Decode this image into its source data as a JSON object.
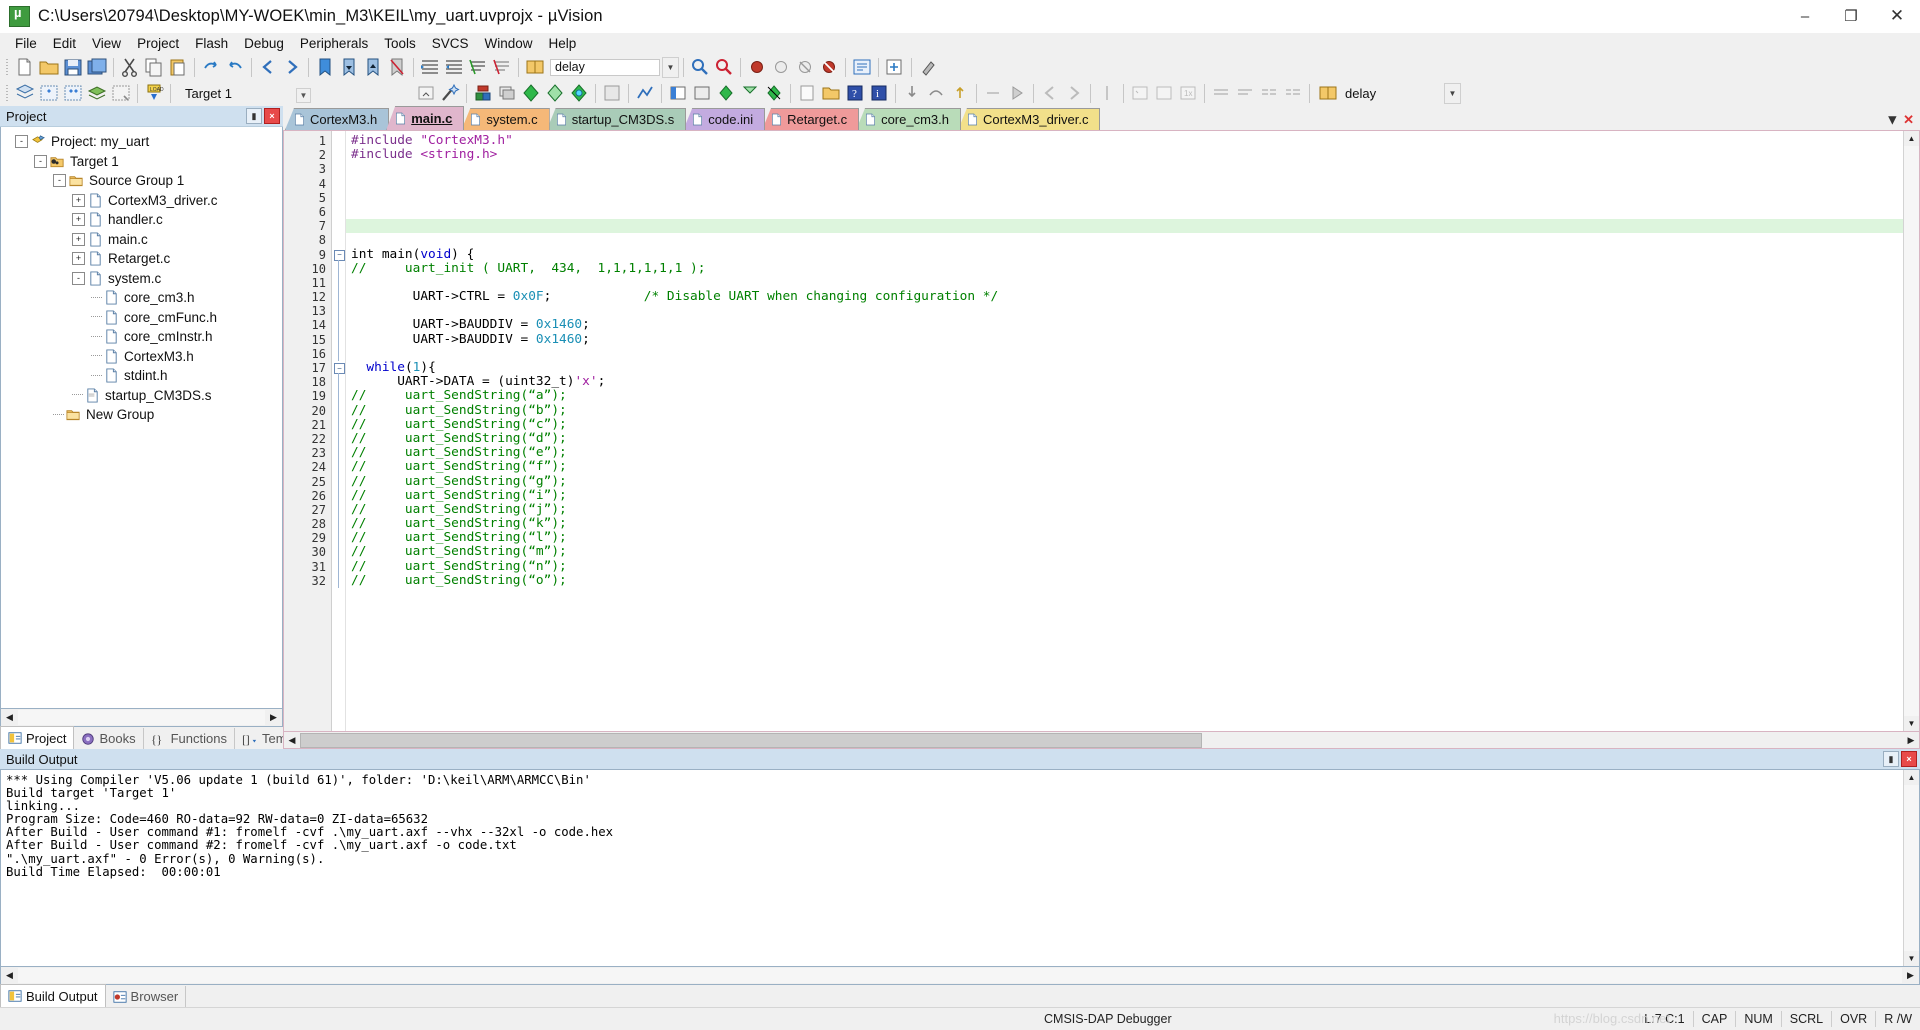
{
  "window": {
    "title": "C:\\Users\\20794\\Desktop\\MY-WOEK\\min_M3\\KEIL\\my_uart.uvprojx - µVision",
    "minimize": "–",
    "maximize": "❐",
    "close": "✕"
  },
  "menubar": {
    "items": [
      {
        "label": "File"
      },
      {
        "label": "Edit"
      },
      {
        "label": "View"
      },
      {
        "label": "Project"
      },
      {
        "label": "Flash"
      },
      {
        "label": "Debug"
      },
      {
        "label": "Peripherals"
      },
      {
        "label": "Tools"
      },
      {
        "label": "SVCS"
      },
      {
        "label": "Window"
      },
      {
        "label": "Help"
      }
    ]
  },
  "toolbar2": {
    "target_value": "Target 1",
    "target_arrow": "▼"
  },
  "toolbar1": {
    "find_value": "delay",
    "find_arrow": "▼",
    "zoom_value": ""
  },
  "project_pane": {
    "caption": "Project",
    "pin": "▮",
    "close": "×",
    "tree": [
      {
        "depth": 0,
        "expander": "-",
        "icon": "project-icon",
        "label": "Project: my_uart"
      },
      {
        "depth": 1,
        "expander": "-",
        "icon": "target-icon",
        "label": "Target 1"
      },
      {
        "depth": 2,
        "expander": "-",
        "icon": "folder-icon",
        "label": "Source Group 1"
      },
      {
        "depth": 3,
        "expander": "+",
        "icon": "c-file-icon",
        "label": "CortexM3_driver.c"
      },
      {
        "depth": 3,
        "expander": "+",
        "icon": "c-file-icon",
        "label": "handler.c"
      },
      {
        "depth": 3,
        "expander": "+",
        "icon": "c-file-icon",
        "label": "main.c"
      },
      {
        "depth": 3,
        "expander": "+",
        "icon": "c-file-icon",
        "label": "Retarget.c"
      },
      {
        "depth": 3,
        "expander": "-",
        "icon": "c-file-icon",
        "label": "system.c"
      },
      {
        "depth": 4,
        "expander": "",
        "icon": "h-file-icon",
        "label": "core_cm3.h"
      },
      {
        "depth": 4,
        "expander": "",
        "icon": "h-file-icon",
        "label": "core_cmFunc.h"
      },
      {
        "depth": 4,
        "expander": "",
        "icon": "h-file-icon",
        "label": "core_cmInstr.h"
      },
      {
        "depth": 4,
        "expander": "",
        "icon": "h-file-icon",
        "label": "CortexM3.h"
      },
      {
        "depth": 4,
        "expander": "",
        "icon": "h-file-icon",
        "label": "stdint.h"
      },
      {
        "depth": 3,
        "expander": "",
        "icon": "asm-file-icon",
        "label": "startup_CM3DS.s"
      },
      {
        "depth": 2,
        "expander": "",
        "icon": "folder-icon",
        "label": "New Group"
      }
    ],
    "tabs": [
      {
        "label": "Project",
        "icon": "project-tab-icon",
        "active": true
      },
      {
        "label": "Books",
        "icon": "books-tab-icon",
        "active": false
      },
      {
        "label": "Functions",
        "icon": "functions-tab-icon",
        "active": false
      },
      {
        "label": "Templates",
        "icon": "templates-tab-icon",
        "active": false
      }
    ]
  },
  "editor": {
    "tabs": [
      {
        "label": "CortexM3.h",
        "color": "#a9c4d8",
        "active": false
      },
      {
        "label": "main.c",
        "color": "#e0b6cc",
        "active": true
      },
      {
        "label": "system.c",
        "color": "#f5b878",
        "active": false
      },
      {
        "label": "startup_CM3DS.s",
        "color": "#a9ccb8",
        "active": false
      },
      {
        "label": "code.ini",
        "color": "#c3abe0",
        "active": false
      },
      {
        "label": "Retarget.c",
        "color": "#ef9a9a",
        "active": false
      },
      {
        "label": "core_cm3.h",
        "color": "#b9dcb9",
        "active": false
      },
      {
        "label": "CortexM3_driver.c",
        "color": "#f2e08a",
        "active": false
      }
    ],
    "tab_scroll_left": "◀",
    "tab_scroll_right": "▶",
    "tab_close": "✕",
    "first_line": 1,
    "line_count": 32,
    "highlight_line": 7,
    "fold_lines": [
      9,
      17
    ],
    "lines": [
      {
        "n": 1,
        "segs": [
          {
            "t": "#include ",
            "c": "tk-pre"
          },
          {
            "t": "\"CortexM3.h\"",
            "c": "tk-str"
          }
        ]
      },
      {
        "n": 2,
        "segs": [
          {
            "t": "#include ",
            "c": "tk-pre"
          },
          {
            "t": "<string.h>",
            "c": "tk-str"
          }
        ]
      },
      {
        "n": 3,
        "segs": []
      },
      {
        "n": 4,
        "segs": []
      },
      {
        "n": 5,
        "segs": []
      },
      {
        "n": 6,
        "segs": []
      },
      {
        "n": 7,
        "segs": []
      },
      {
        "n": 8,
        "segs": []
      },
      {
        "n": 9,
        "segs": [
          {
            "t": "int main(",
            "c": ""
          },
          {
            "t": "void",
            "c": "tk-kw"
          },
          {
            "t": ") {",
            "c": ""
          }
        ]
      },
      {
        "n": 10,
        "segs": [
          {
            "t": "//     uart_init ( UART,  434,  1,1,1,1,1,1 );",
            "c": "tk-com"
          }
        ]
      },
      {
        "n": 11,
        "segs": []
      },
      {
        "n": 12,
        "segs": [
          {
            "t": "        UART->CTRL = ",
            "c": ""
          },
          {
            "t": "0x0F",
            "c": "tk-num"
          },
          {
            "t": ";            ",
            "c": ""
          },
          {
            "t": "/* Disable UART when changing configuration */",
            "c": "tk-com"
          }
        ]
      },
      {
        "n": 13,
        "segs": []
      },
      {
        "n": 14,
        "segs": [
          {
            "t": "        UART->BAUDDIV = ",
            "c": ""
          },
          {
            "t": "0x1460",
            "c": "tk-num"
          },
          {
            "t": ";",
            "c": ""
          }
        ]
      },
      {
        "n": 15,
        "segs": [
          {
            "t": "        UART->BAUDDIV = ",
            "c": ""
          },
          {
            "t": "0x1460",
            "c": "tk-num"
          },
          {
            "t": ";",
            "c": ""
          }
        ]
      },
      {
        "n": 16,
        "segs": []
      },
      {
        "n": 17,
        "segs": [
          {
            "t": "  ",
            "c": ""
          },
          {
            "t": "while",
            "c": "tk-kw"
          },
          {
            "t": "(",
            "c": ""
          },
          {
            "t": "1",
            "c": "tk-num"
          },
          {
            "t": "){",
            "c": ""
          }
        ]
      },
      {
        "n": 18,
        "segs": [
          {
            "t": "      UART->DATA = (uint32_t)",
            "c": ""
          },
          {
            "t": "'x'",
            "c": "tk-chr"
          },
          {
            "t": ";",
            "c": ""
          }
        ]
      },
      {
        "n": 19,
        "segs": [
          {
            "t": "//     uart_SendString(“a”);",
            "c": "tk-com"
          }
        ]
      },
      {
        "n": 20,
        "segs": [
          {
            "t": "//     uart_SendString(“b”);",
            "c": "tk-com"
          }
        ]
      },
      {
        "n": 21,
        "segs": [
          {
            "t": "//     uart_SendString(“c”);",
            "c": "tk-com"
          }
        ]
      },
      {
        "n": 22,
        "segs": [
          {
            "t": "//     uart_SendString(“d”);",
            "c": "tk-com"
          }
        ]
      },
      {
        "n": 23,
        "segs": [
          {
            "t": "//     uart_SendString(“e”);",
            "c": "tk-com"
          }
        ]
      },
      {
        "n": 24,
        "segs": [
          {
            "t": "//     uart_SendString(“f”);",
            "c": "tk-com"
          }
        ]
      },
      {
        "n": 25,
        "segs": [
          {
            "t": "//     uart_SendString(“g”);",
            "c": "tk-com"
          }
        ]
      },
      {
        "n": 26,
        "segs": [
          {
            "t": "//     uart_SendString(“i”);",
            "c": "tk-com"
          }
        ]
      },
      {
        "n": 27,
        "segs": [
          {
            "t": "//     uart_SendString(“j”);",
            "c": "tk-com"
          }
        ]
      },
      {
        "n": 28,
        "segs": [
          {
            "t": "//     uart_SendString(“k”);",
            "c": "tk-com"
          }
        ]
      },
      {
        "n": 29,
        "segs": [
          {
            "t": "//     uart_SendString(“l”);",
            "c": "tk-com"
          }
        ]
      },
      {
        "n": 30,
        "segs": [
          {
            "t": "//     uart_SendString(“m”);",
            "c": "tk-com"
          }
        ]
      },
      {
        "n": 31,
        "segs": [
          {
            "t": "//     uart_SendString(“n”);",
            "c": "tk-com"
          }
        ]
      },
      {
        "n": 32,
        "segs": [
          {
            "t": "//     uart_SendString(“o”);",
            "c": "tk-com"
          }
        ]
      }
    ]
  },
  "build_output": {
    "caption": "Build Output",
    "pin": "▮",
    "close": "×",
    "lines": [
      "*** Using Compiler 'V5.06 update 1 (build 61)', folder: 'D:\\keil\\ARM\\ARMCC\\Bin'",
      "Build target 'Target 1'",
      "linking...",
      "Program Size: Code=460 RO-data=92 RW-data=0 ZI-data=65632",
      "After Build - User command #1: fromelf -cvf .\\my_uart.axf --vhx --32xl -o code.hex",
      "After Build - User command #2: fromelf -cvf .\\my_uart.axf -o code.txt",
      "\".\\my_uart.axf\" - 0 Error(s), 0 Warning(s).",
      "Build Time Elapsed:  00:00:01"
    ],
    "tabs": [
      {
        "label": "Build Output",
        "icon": "build-output-icon",
        "active": true
      },
      {
        "label": "Browser",
        "icon": "browser-icon",
        "active": false
      }
    ]
  },
  "statusbar": {
    "debugger": "CMSIS-DAP Debugger",
    "cursor": "L:7 C:1",
    "cap": "CAP",
    "num": "NUM",
    "scrl": "SCRL",
    "ovr": "OVR",
    "rw": "R /W"
  },
  "watermark": "https://blog.csdn.net",
  "colors": {
    "caption_bg": "#cfe0ef",
    "chrome_bg": "#f0f0f0",
    "highlight_line": "#ddf5dd",
    "comment": "#008000",
    "keyword": "#0000cc",
    "number": "#1a8fb5",
    "string": "#a020a0",
    "preproc": "#7b2f8c"
  }
}
